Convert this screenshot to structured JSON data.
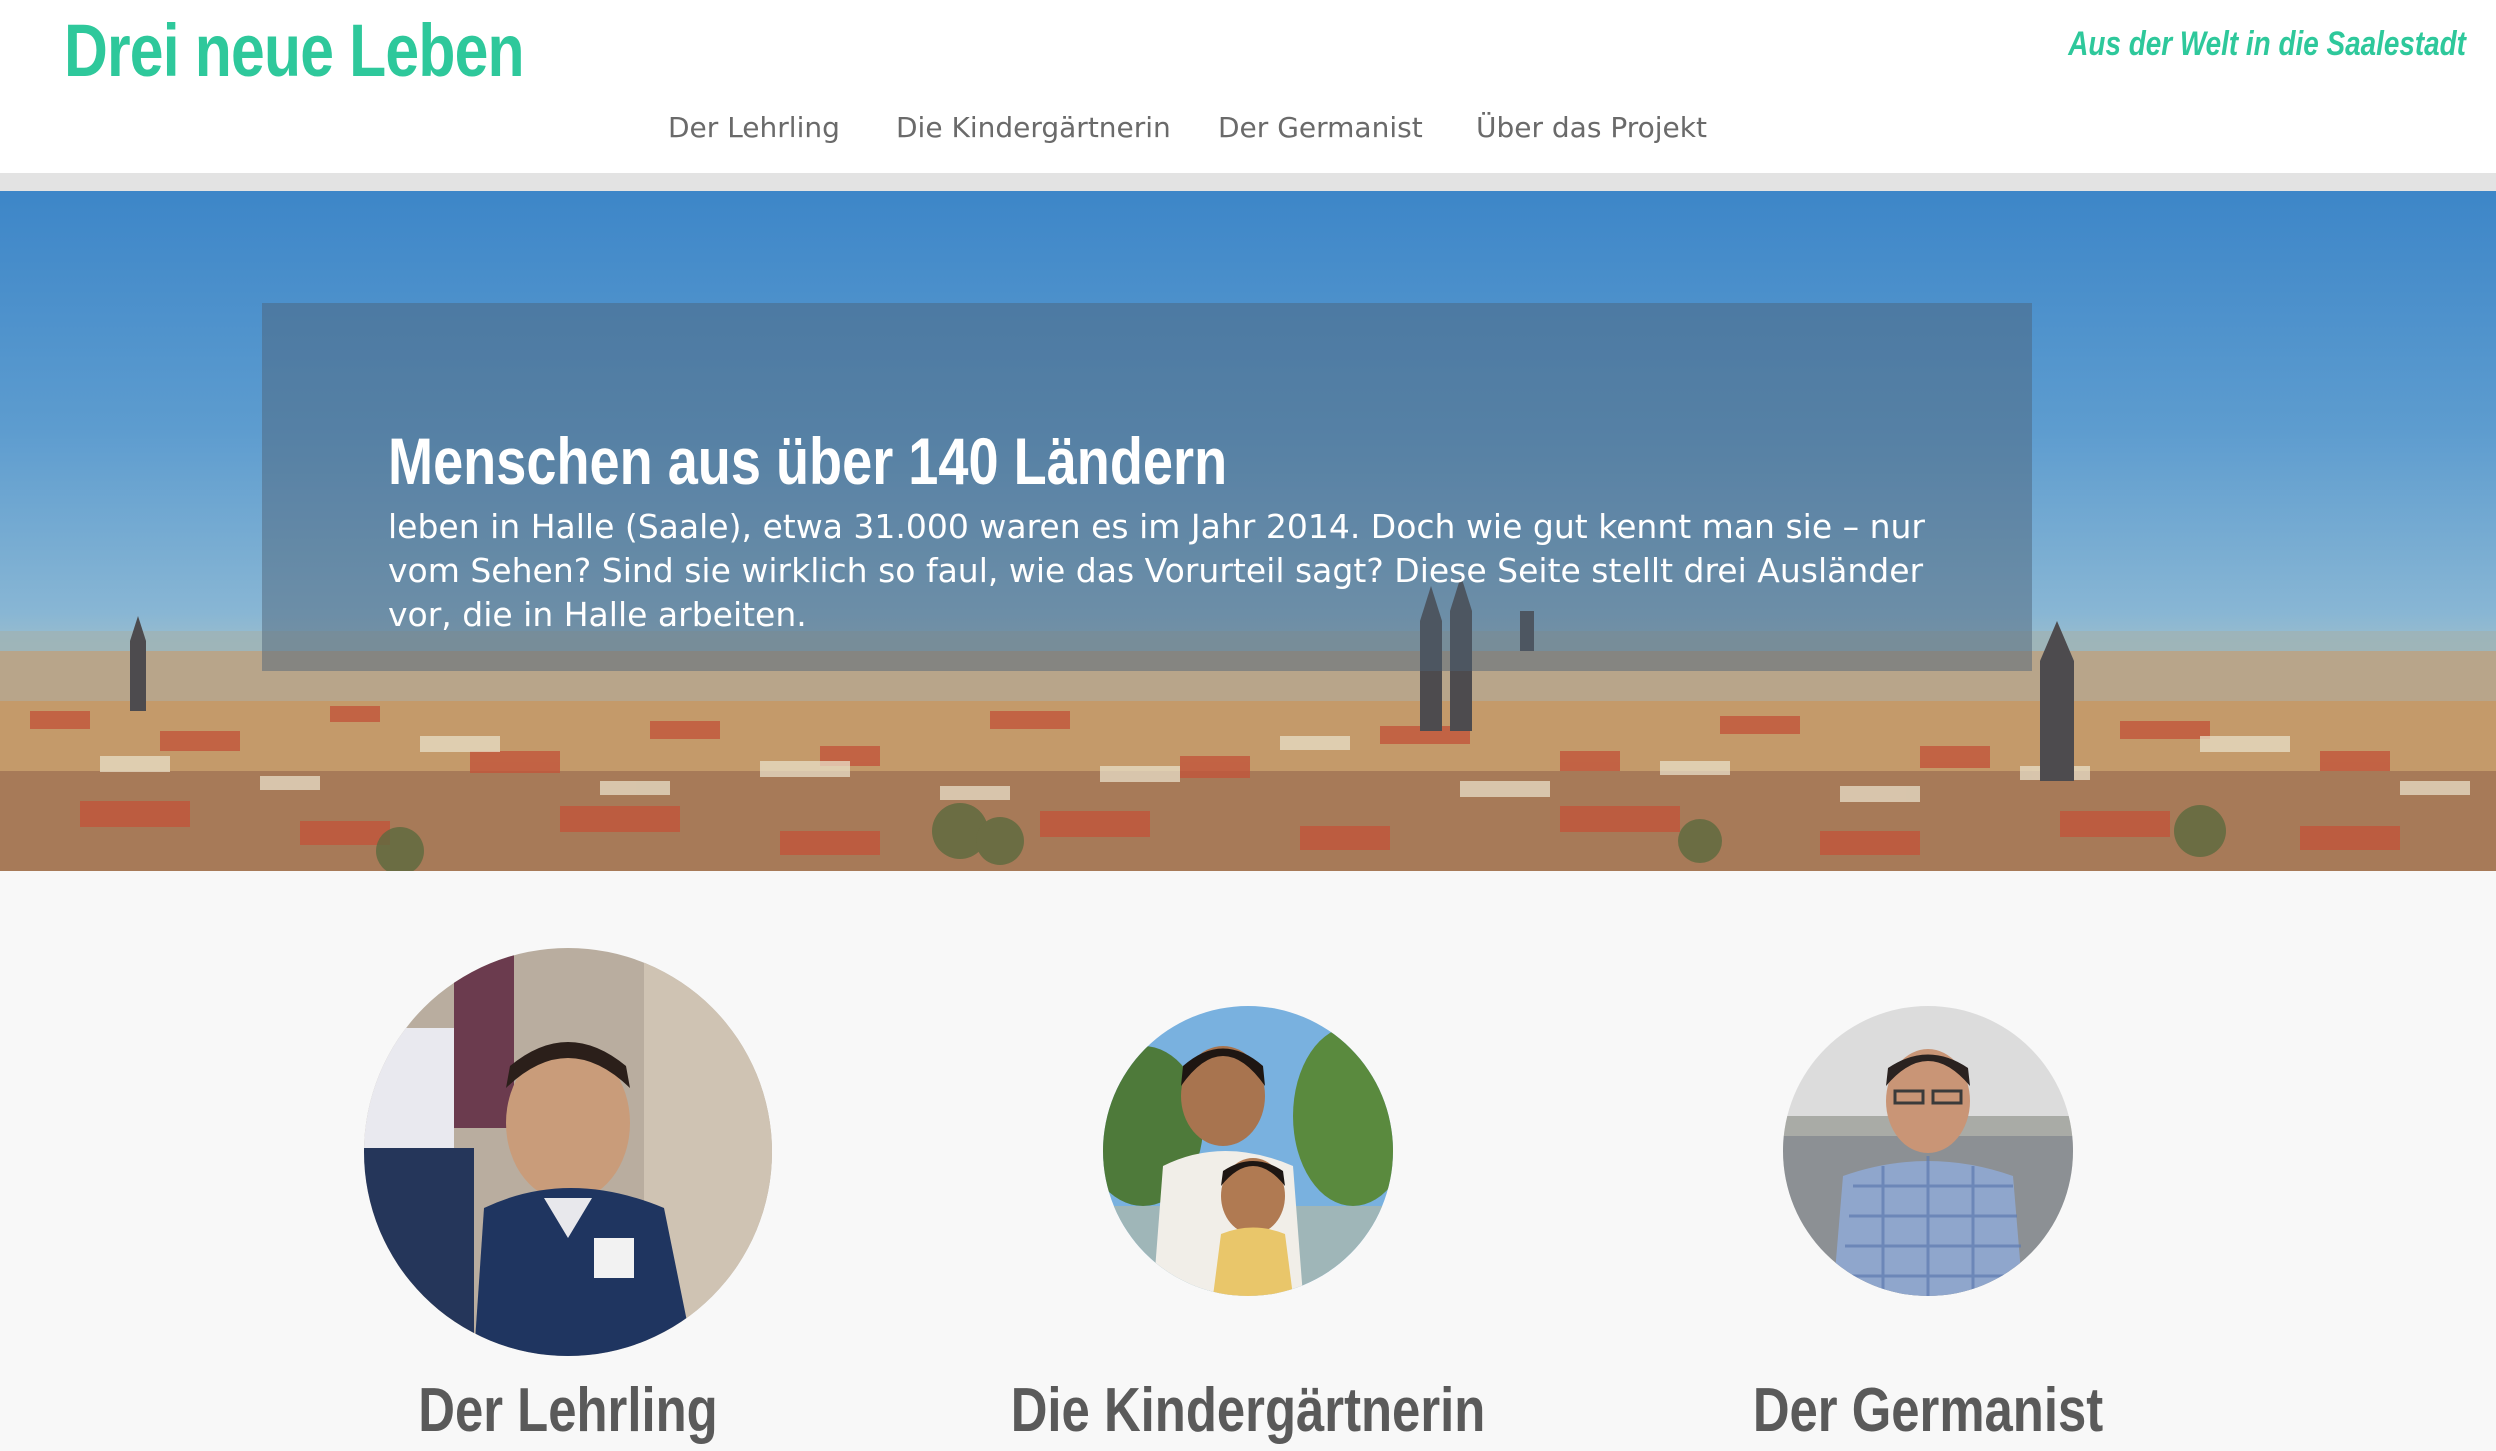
{
  "header": {
    "site_title": "Drei neue Leben",
    "tagline": "Aus der Welt in die Saalestadt"
  },
  "nav": {
    "items": [
      {
        "label": "Der Lehrling"
      },
      {
        "label": "Die Kindergärtnerin"
      },
      {
        "label": "Der Germanist"
      },
      {
        "label": "Über das Projekt"
      }
    ]
  },
  "hero": {
    "heading": "Menschen aus über 140 Ländern",
    "text": "leben in Halle (Saale), etwa 31.000 waren es im Jahr 2014. Doch wie gut kennt man sie – nur vom Sehen? Sind sie wirklich so faul, wie das Vorurteil sagt? Diese Seite stellt drei Ausländer vor, die in Halle arbeiten."
  },
  "profiles": [
    {
      "name": "Der Lehrling"
    },
    {
      "name": "Die Kindergärtnerin"
    },
    {
      "name": "Der Germanist"
    }
  ],
  "colors": {
    "accent": "#2ec89b",
    "nav_text": "#6a6a6a",
    "profile_name": "#5a5a5a",
    "page_background": "#f8f8f8"
  }
}
